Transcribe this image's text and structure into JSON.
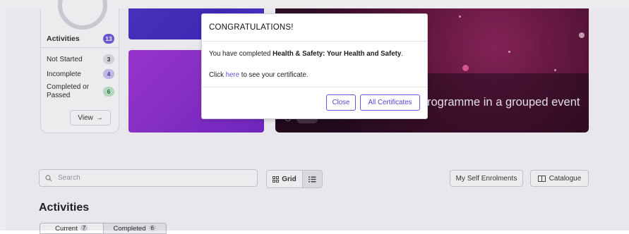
{
  "summary": {
    "title": "Activities",
    "total": "13",
    "rows": [
      {
        "label": "Not Started",
        "count": "3"
      },
      {
        "label": "Incomplete",
        "count": "4"
      },
      {
        "label": "Completed or Passed",
        "count": "6"
      }
    ],
    "view_label": "View",
    "view_arrow": "→"
  },
  "hero": {
    "title": "rogramme in a grouped event"
  },
  "toolbar": {
    "search_placeholder": "Search",
    "grid_label": "Grid",
    "self_enrolments_label": "My Self Enrolments",
    "catalogue_label": "Catalogue"
  },
  "activities": {
    "heading": "Activities",
    "tabs": [
      {
        "label": "Current",
        "count": "7"
      },
      {
        "label": "Completed",
        "count": "6"
      }
    ]
  },
  "modal": {
    "title": "CONGRATULATIONS!",
    "line1_prefix": "You have completed ",
    "line1_bold": "Health & Safety: Your Health and Safety",
    "line1_suffix": ".",
    "line2_prefix": "Click ",
    "line2_link": "here",
    "line2_suffix": " to see your certificate.",
    "close_label": "Close",
    "all_certificates_label": "All Certificates"
  },
  "colors": {
    "accent": "#6b52d8",
    "badge_total": "#6f5ad8",
    "badge_completed": "#bfe8c8"
  }
}
